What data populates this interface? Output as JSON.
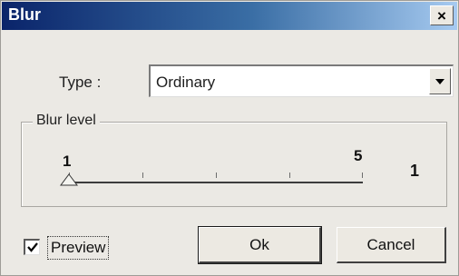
{
  "window": {
    "title": "Blur",
    "close_label": "×"
  },
  "type_field": {
    "label": "Type :",
    "value": "Ordinary",
    "icon": "chevron-down-icon"
  },
  "blur_level": {
    "group_label": "Blur level",
    "min_label": "1",
    "max_label": "5",
    "current_value": "1",
    "slider": {
      "min": 1,
      "max": 5,
      "value": 1
    }
  },
  "preview": {
    "label": "Preview",
    "checked": true
  },
  "buttons": {
    "ok_label": "Ok",
    "cancel_label": "Cancel"
  },
  "colors": {
    "titlebar_start": "#0a246a",
    "titlebar_end": "#a6caf0",
    "dialog_bg": "#ebe9e4"
  }
}
